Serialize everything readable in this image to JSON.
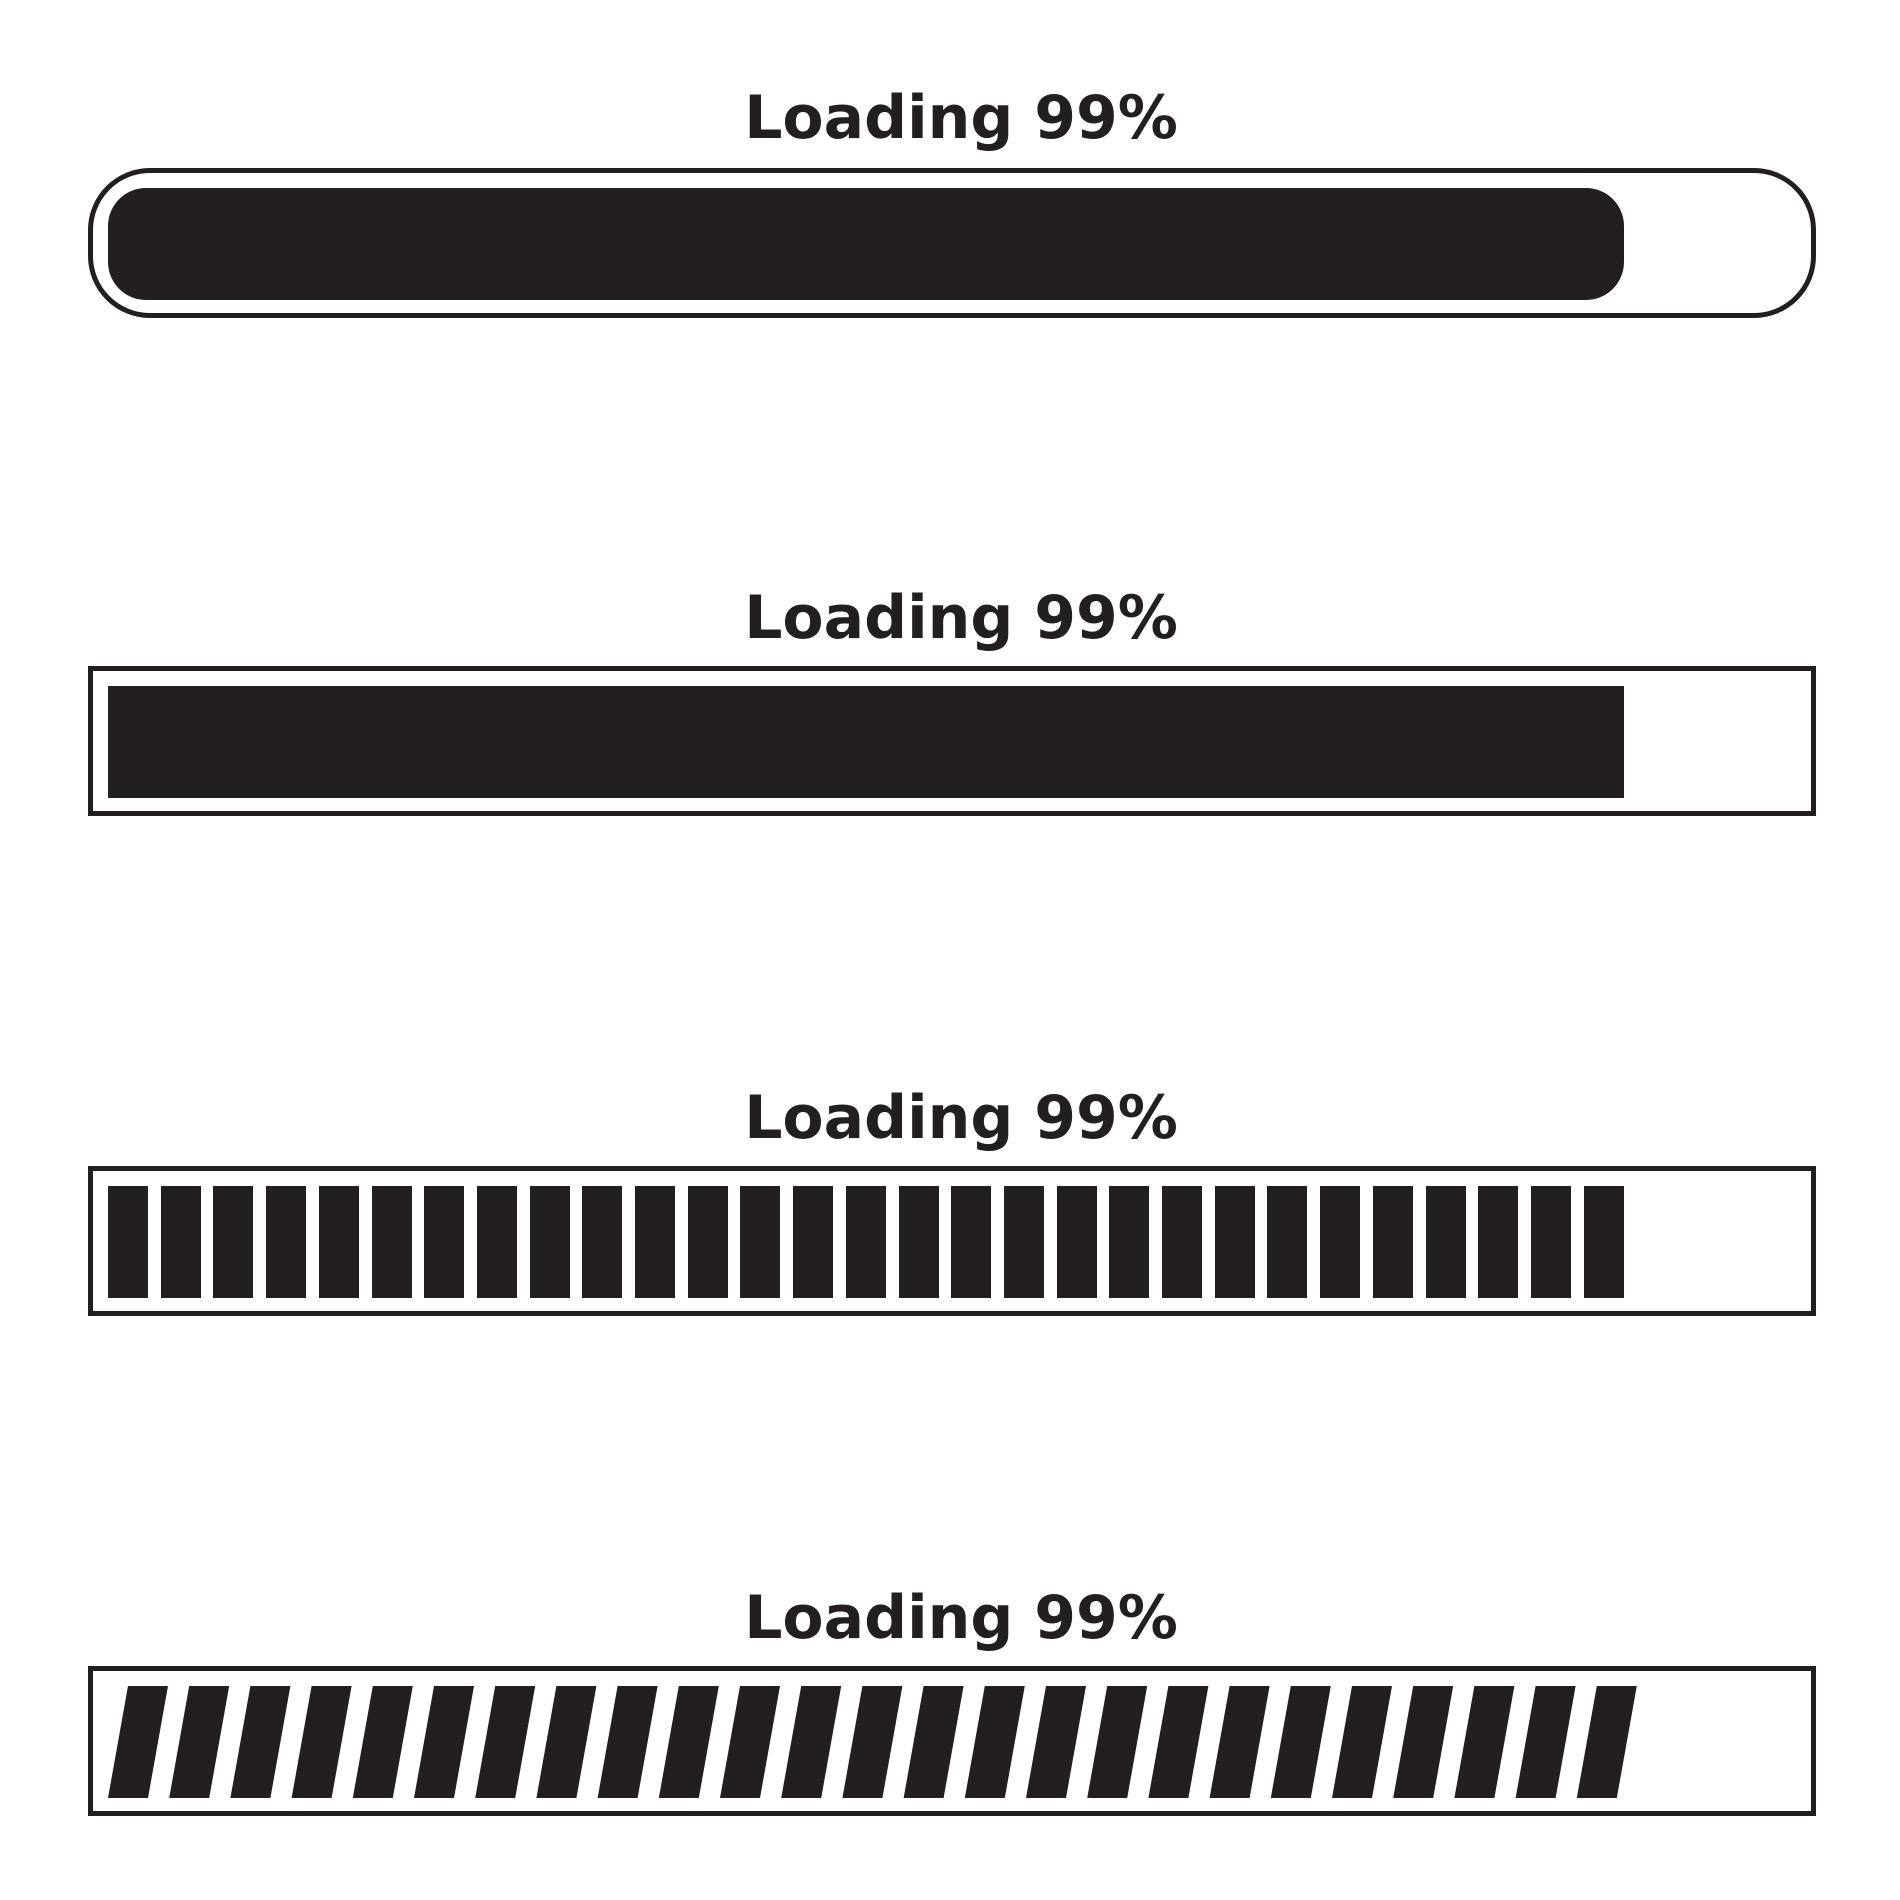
{
  "loaders": [
    {
      "label": "Loading 99%",
      "style": "rounded",
      "progress": 0.99
    },
    {
      "label": "Loading 99%",
      "style": "square",
      "progress": 0.99
    },
    {
      "label": "Loading 99%",
      "style": "segmented",
      "progress": 0.99,
      "segments": 29
    },
    {
      "label": "Loading 99%",
      "style": "slanted",
      "progress": 0.99,
      "segments": 25
    }
  ],
  "colors": {
    "ink": "#231f20",
    "background": "#ffffff"
  }
}
